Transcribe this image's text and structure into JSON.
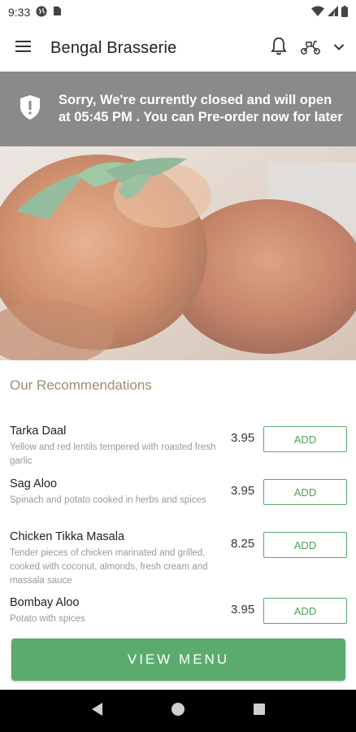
{
  "status_bar": {
    "time": "9:33",
    "icons": [
      "vpn-globe-icon",
      "sim-card-icon",
      "wifi-icon",
      "signal-icon",
      "battery-icon"
    ]
  },
  "app_bar": {
    "title": "Bengal Brasserie",
    "icons": [
      "menu-icon",
      "bell-icon",
      "delivery-scooter-icon",
      "chevron-down-icon"
    ]
  },
  "banner": {
    "icon": "shield-alert-icon",
    "message": "Sorry, We're currently closed and will open at 05:45 PM . You can Pre-order now for later",
    "background": "#8a8a8a"
  },
  "hero": {
    "image": "grilled-chicken-photo"
  },
  "recommendations": {
    "title": "Our Recommendations",
    "add_label": "ADD",
    "items": [
      {
        "name": "Tarka Daal",
        "description": "Yellow and red lentils tempered with roasted fresh garlic",
        "price": "3.95"
      },
      {
        "name": "Sag Aloo",
        "description": "Spinach and potato cooked in herbs and spices",
        "price": "3.95"
      },
      {
        "name": "Chicken Tikka Masala",
        "description": "Tender pieces of chicken marinated and grilled, cooked with coconut, almonds, fresh cream and massala sauce",
        "price": "8.25"
      },
      {
        "name": "Bombay Aloo",
        "description": "Potato with spices",
        "price": "3.95"
      }
    ]
  },
  "view_menu": {
    "label": "VIEW MENU",
    "color": "#5bab6e"
  },
  "nav_bar": {
    "icons": [
      "back-icon",
      "home-icon",
      "recents-icon"
    ]
  },
  "colors": {
    "accent_green": "#5bab6e",
    "section_title": "#a08d70"
  }
}
